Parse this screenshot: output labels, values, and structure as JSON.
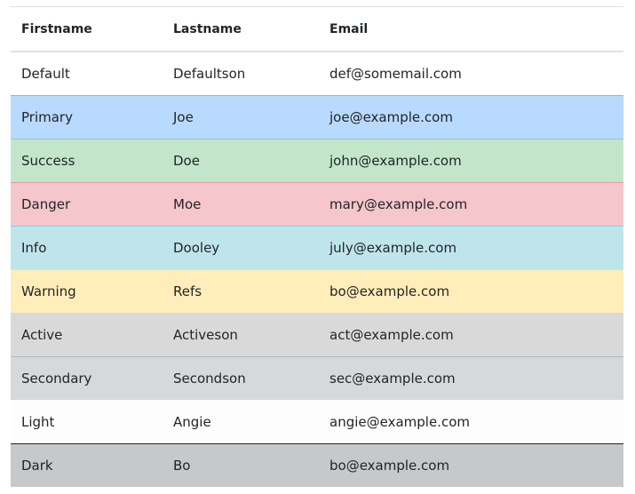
{
  "table": {
    "headers": [
      "Firstname",
      "Lastname",
      "Email"
    ],
    "rows": [
      {
        "variant": "default",
        "firstname": "Default",
        "lastname": "Defaultson",
        "email": "def@somemail.com"
      },
      {
        "variant": "primary",
        "firstname": "Primary",
        "lastname": "Joe",
        "email": "joe@example.com"
      },
      {
        "variant": "success",
        "firstname": "Success",
        "lastname": "Doe",
        "email": "john@example.com"
      },
      {
        "variant": "danger",
        "firstname": "Danger",
        "lastname": "Moe",
        "email": "mary@example.com"
      },
      {
        "variant": "info",
        "firstname": "Info",
        "lastname": "Dooley",
        "email": "july@example.com"
      },
      {
        "variant": "warning",
        "firstname": "Warning",
        "lastname": "Refs",
        "email": "bo@example.com"
      },
      {
        "variant": "active",
        "firstname": "Active",
        "lastname": "Activeson",
        "email": "act@example.com"
      },
      {
        "variant": "secondary",
        "firstname": "Secondary",
        "lastname": "Secondson",
        "email": "sec@example.com"
      },
      {
        "variant": "light",
        "firstname": "Light",
        "lastname": "Angie",
        "email": "angie@example.com"
      },
      {
        "variant": "dark",
        "firstname": "Dark",
        "lastname": "Bo",
        "email": "bo@example.com"
      }
    ]
  },
  "colors": {
    "default": "#ffffff",
    "primary": "#b8daff",
    "success": "#c3e6cb",
    "danger": "#f5c6cb",
    "info": "#bee5eb",
    "warning": "#ffeeba",
    "active": "#d9d9d9",
    "secondary": "#d6d8db",
    "light": "#fdfdfe",
    "dark": "#c6c8ca"
  }
}
